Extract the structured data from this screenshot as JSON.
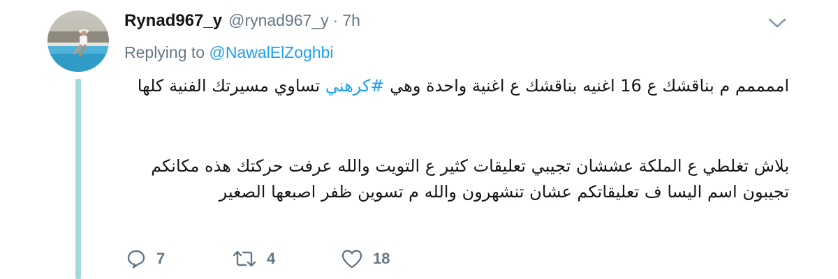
{
  "tweet": {
    "display_name": "Rynad967_y",
    "handle": "@rynad967_y",
    "separator": "·",
    "time": "7h",
    "replying_prefix": "Replying to ",
    "replying_to": "@NawalElZoghbi",
    "para1_before": "اممممم م بناقشك ع 16 اغنيه بناقشك ع اغنية واحدة وهي ",
    "hashtag": "#كرهني",
    "para1_after": " تساوي مسيرتك الفنية كلها",
    "para2": "بلاش تغلطي ع الملكة عششان تجيبي تعليقات كثير ع التويت والله عرفت حركتك هذه مكانكم تجيبون اسم اليسا ف تعليقاتكم عشان تنشهرون والله م تسوين ظفر اصبعها الصغير"
  },
  "actions": {
    "reply_count": "7",
    "retweet_count": "4",
    "like_count": "18"
  },
  "icons": {
    "reply": "reply-icon",
    "retweet": "retweet-icon",
    "like": "heart-icon",
    "more": "chevron-down-icon"
  },
  "colors": {
    "link": "#1da1f2",
    "muted": "#657786",
    "thread_line": "#a5dad8"
  }
}
